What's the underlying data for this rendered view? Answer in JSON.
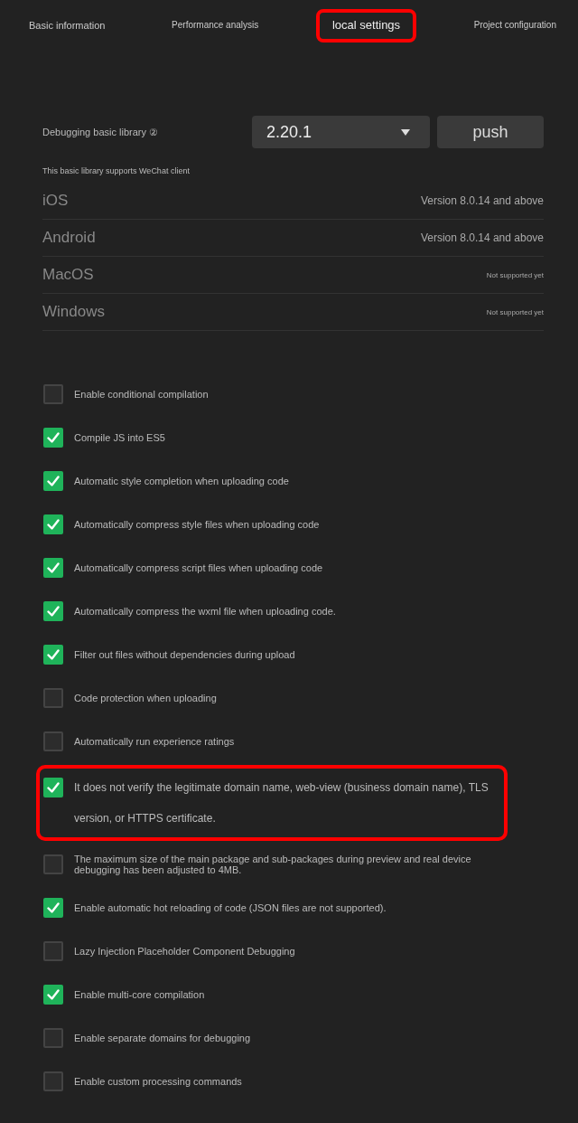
{
  "tabs": [
    {
      "label": "Basic information",
      "selected": false,
      "highlighted": false
    },
    {
      "label": "Performance analysis",
      "selected": false,
      "highlighted": false
    },
    {
      "label": "local settings",
      "selected": true,
      "highlighted": true
    },
    {
      "label": "Project configuration",
      "selected": false,
      "highlighted": false
    }
  ],
  "library": {
    "label": "Debugging basic library ②",
    "version": "2.20.1",
    "push_button": "push"
  },
  "clients": {
    "caption": "This basic library supports WeChat client",
    "rows": [
      {
        "platform": "iOS",
        "support": "Version 8.0.14 and above"
      },
      {
        "platform": "Android",
        "support": "Version 8.0.14 and above"
      },
      {
        "platform": "MacOS",
        "support": "Not supported yet"
      },
      {
        "platform": "Windows",
        "support": "Not supported yet"
      }
    ]
  },
  "options": [
    {
      "label": "Enable conditional compilation",
      "checked": false,
      "highlighted": false
    },
    {
      "label": "Compile JS into ES5",
      "checked": true,
      "highlighted": false
    },
    {
      "label": "Automatic style completion when uploading code",
      "checked": true,
      "highlighted": false
    },
    {
      "label": "Automatically compress style files when uploading code",
      "checked": true,
      "highlighted": false
    },
    {
      "label": "Automatically compress script files when uploading code",
      "checked": true,
      "highlighted": false
    },
    {
      "label": "Automatically compress the wxml file when uploading code.",
      "checked": true,
      "highlighted": false
    },
    {
      "label": "Filter out files without dependencies during upload",
      "checked": true,
      "highlighted": false
    },
    {
      "label": "Code protection when uploading",
      "checked": false,
      "highlighted": false
    },
    {
      "label": "Automatically run experience ratings",
      "checked": false,
      "highlighted": false
    },
    {
      "label": "It does not verify the legitimate domain name, web-view (business domain name), TLS version, or HTTPS certificate.",
      "checked": true,
      "highlighted": true
    },
    {
      "label": "The maximum size of the main package and sub-packages during preview and real device debugging has been adjusted to 4MB.",
      "checked": false,
      "highlighted": false
    },
    {
      "label": "Enable automatic hot reloading of code (JSON files are not supported).",
      "checked": true,
      "highlighted": false
    },
    {
      "label": "Lazy Injection Placeholder Component Debugging",
      "checked": false,
      "highlighted": false
    },
    {
      "label": "Enable multi-core compilation",
      "checked": true,
      "highlighted": false
    },
    {
      "label": "Enable separate domains for debugging",
      "checked": false,
      "highlighted": false
    },
    {
      "label": "Enable custom processing commands",
      "checked": false,
      "highlighted": false
    }
  ]
}
